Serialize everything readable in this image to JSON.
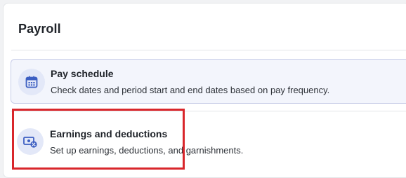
{
  "page": {
    "title": "Payroll"
  },
  "settings": [
    {
      "title": "Pay schedule",
      "description": "Check dates and period start and end dates based on pay frequency.",
      "icon": "calendar-icon"
    },
    {
      "title": "Earnings and deductions",
      "description": "Set up earnings, deductions, and garnishments.",
      "icon": "money-percent-icon"
    }
  ],
  "colors": {
    "icon_accent": "#3d5fc2",
    "icon_bg": "#e3e8f8",
    "selected_row_bg": "#f3f5fc",
    "highlight": "#d9262b"
  }
}
